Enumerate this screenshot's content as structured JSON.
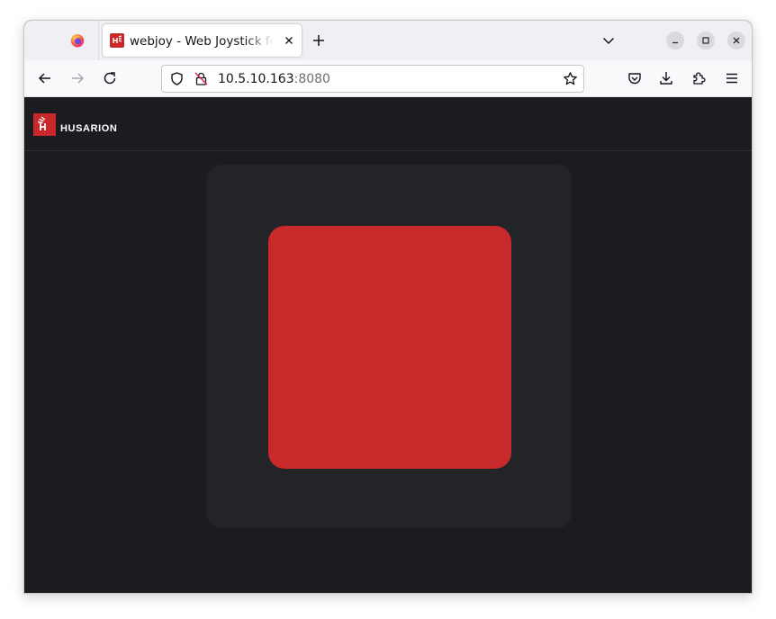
{
  "browser": {
    "tab": {
      "title": "webjoy - Web Joystick for",
      "favicon": "husarion-favicon"
    },
    "url": {
      "host": "10.5.10.163",
      "port": ":8080"
    },
    "icons": {
      "browser": "firefox-icon",
      "close_tab": "close-icon",
      "new_tab": "plus-icon",
      "tab_list": "chevron-down-icon",
      "minimize": "minimize-icon",
      "maximize": "maximize-icon",
      "close_window": "close-icon",
      "back": "arrow-left-icon",
      "forward": "arrow-right-icon",
      "reload": "reload-icon",
      "tracking": "shield-icon",
      "insecure": "lock-crossed-icon",
      "bookmark": "star-icon",
      "pocket": "pocket-icon",
      "downloads": "download-icon",
      "extensions": "puzzle-icon",
      "menu": "hamburger-menu-icon"
    }
  },
  "page": {
    "logo": {
      "text": "HUSARION"
    },
    "joystick": {
      "pad_color": "#222428",
      "knob_color": "#c8292a",
      "background": "#1b1c20"
    }
  }
}
